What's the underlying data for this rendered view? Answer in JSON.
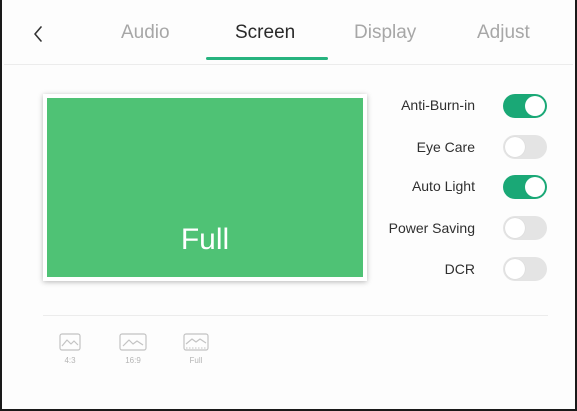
{
  "nav": {
    "back_icon": "chevron-left-icon",
    "tabs": [
      {
        "label": "Audio",
        "active": false
      },
      {
        "label": "Screen",
        "active": true
      },
      {
        "label": "Display",
        "active": false
      },
      {
        "label": "Adjust",
        "active": false
      }
    ]
  },
  "preview": {
    "label": "Full",
    "color": "#4fc275"
  },
  "settings": [
    {
      "label": "Anti-Burn-in",
      "enabled": true
    },
    {
      "label": "Eye Care",
      "enabled": false
    },
    {
      "label": "Auto Light",
      "enabled": true
    },
    {
      "label": "Power Saving",
      "enabled": false
    },
    {
      "label": "DCR",
      "enabled": false
    }
  ],
  "aspect_ratios": [
    {
      "label": "4:3",
      "icon": "image-icon"
    },
    {
      "label": "16:9",
      "icon": "image-icon"
    },
    {
      "label": "Full",
      "icon": "image-icon"
    }
  ],
  "colors": {
    "accent": "#1aa876",
    "toggle_off": "#e4e4e4",
    "inactive_text": "#a7a7a7"
  }
}
